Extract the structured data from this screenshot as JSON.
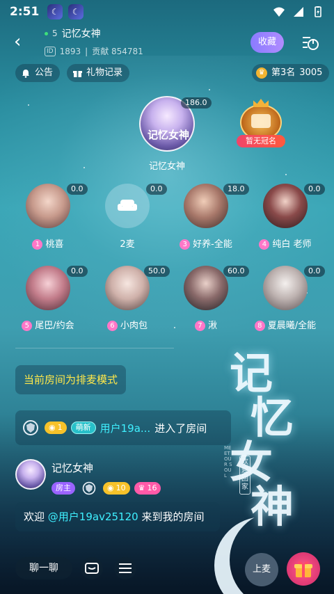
{
  "status_bar": {
    "time": "2:51"
  },
  "header": {
    "online_count": "5",
    "room_name": "记忆女神",
    "room_id_label": "ID",
    "room_id": "1893",
    "contribution": "贡献 854781",
    "fav_label": "收藏"
  },
  "toolbar": {
    "notice_label": "公告",
    "gift_record_label": "礼物记录",
    "rank_label": "第3名",
    "rank_score": "3005"
  },
  "host": {
    "name": "记忆女神",
    "score": "186.0",
    "avatar_text": "记忆女神"
  },
  "crown": {
    "label": "暂无冠名"
  },
  "seats": [
    {
      "num": "1",
      "name": "桃喜",
      "score": "0.0"
    },
    {
      "num": "",
      "name": "2麦",
      "score": "0.0"
    },
    {
      "num": "3",
      "name": "好养-全能",
      "score": "18.0"
    },
    {
      "num": "4",
      "name": "纯白 老师",
      "score": "0.0"
    },
    {
      "num": "5",
      "name": "尾巴/约会",
      "score": "0.0"
    },
    {
      "num": "6",
      "name": "小肉包",
      "score": "50.0"
    },
    {
      "num": "7",
      "name": "湫",
      "score": "60.0"
    },
    {
      "num": "8",
      "name": "夏晨曦/全能",
      "score": "0.0"
    }
  ],
  "decor": {
    "title_chars": [
      "记",
      "忆",
      "女",
      "神"
    ],
    "subtitle": "欢迎回家",
    "en": "MEET OUR SOUL"
  },
  "chat": {
    "system_tip": "当前房间为排麦模式",
    "enter_msg": {
      "level": "1",
      "newbie_label": "萌新",
      "user": "用户19a...",
      "text": "进入了房间"
    },
    "host_msg": {
      "name": "记忆女神",
      "role_label": "房主",
      "gold_level": "10",
      "pink_level": "16",
      "prefix": "欢迎",
      "mention": "@用户19av25120",
      "suffix": "来到我的房间"
    }
  },
  "bottom_bar": {
    "chat_label": "聊一聊",
    "mic_label": "上麦"
  },
  "colors": {
    "accent": "#9a63ff",
    "highlight": "#ffe84a",
    "link": "#3ff0ff",
    "gift": "#d02a6a"
  }
}
